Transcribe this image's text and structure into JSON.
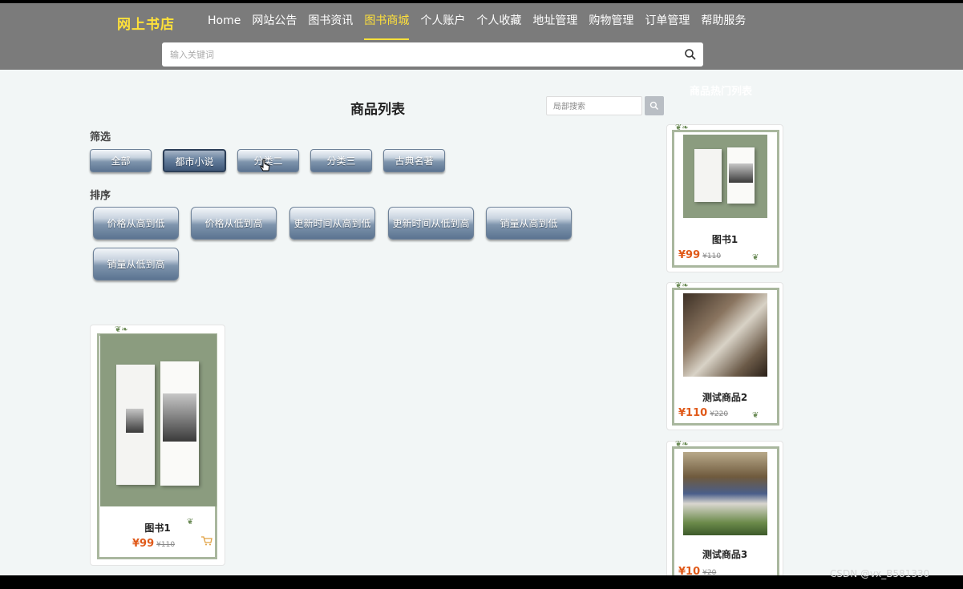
{
  "header": {
    "logo": "网上书店",
    "nav": [
      "Home",
      "网站公告",
      "图书资讯",
      "图书商城",
      "个人账户",
      "个人收藏",
      "地址管理",
      "购物管理",
      "订单管理",
      "帮助服务"
    ],
    "active_nav": "图书商城",
    "search_placeholder": "输入关键词"
  },
  "main": {
    "title": "商品列表",
    "local_search_placeholder": "局部搜索",
    "filter_label": "筛选",
    "filters": [
      "全部",
      "都市小说",
      "分类二",
      "分类三",
      "古典名著"
    ],
    "selected_filter": "都市小说",
    "sort_label": "排序",
    "sorts": [
      "价格从高到低",
      "价格从低到高",
      "更新时间从高到低",
      "更新时间从低到高",
      "销量从高到低",
      "销量从低到高"
    ],
    "product": {
      "name": "图书1",
      "price": "¥99",
      "old_price": "¥110"
    }
  },
  "sidebar": {
    "title": "商品热门列表",
    "items": [
      {
        "name": "图书1",
        "price": "¥99",
        "old_price": "¥110"
      },
      {
        "name": "测试商品2",
        "price": "¥110",
        "old_price": "¥220"
      },
      {
        "name": "测试商品3",
        "price": "¥10",
        "old_price": "¥20"
      }
    ]
  },
  "watermark": "CSDN @vx_B581330",
  "colors": {
    "header_bg": "#7b7b7b",
    "accent": "#ffe13a",
    "price": "#e05a1a",
    "page_bg": "#f2f6f6"
  }
}
